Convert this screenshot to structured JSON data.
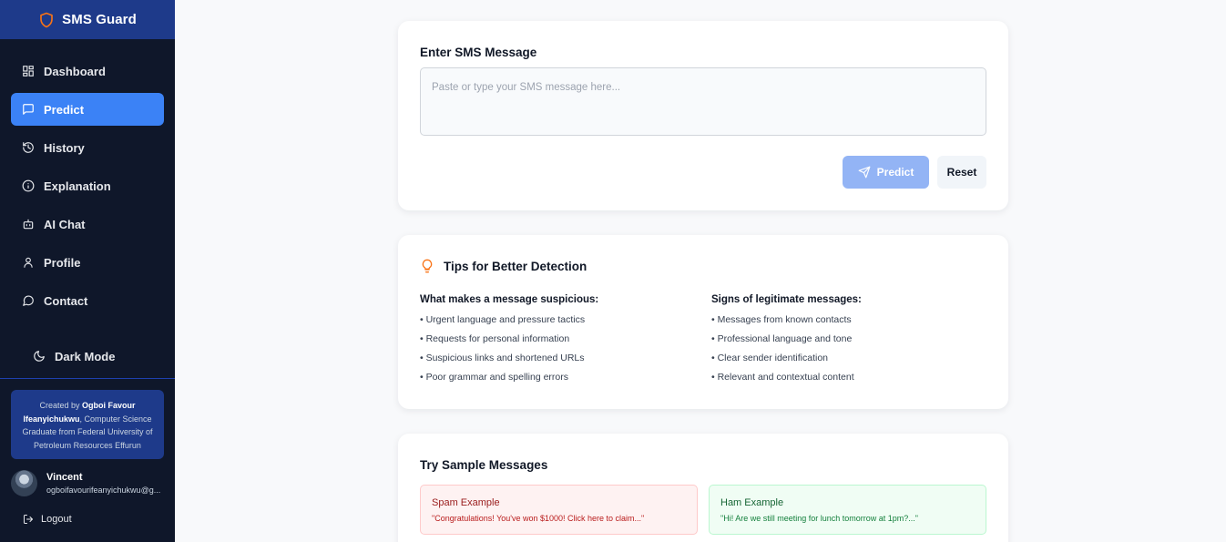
{
  "app": {
    "name": "SMS Guard"
  },
  "sidebar": {
    "items": [
      {
        "label": "Dashboard",
        "icon": "grid-icon"
      },
      {
        "label": "Predict",
        "icon": "message-square-icon",
        "active": true
      },
      {
        "label": "History",
        "icon": "history-icon"
      },
      {
        "label": "Explanation",
        "icon": "info-icon"
      },
      {
        "label": "AI Chat",
        "icon": "bot-icon"
      },
      {
        "label": "Profile",
        "icon": "user-icon"
      },
      {
        "label": "Contact",
        "icon": "message-circle-icon"
      }
    ],
    "dark_mode_label": "Dark Mode",
    "credit": {
      "prefix": "Created by ",
      "name": "Ogboi Favour Ifeanyichukwu",
      "suffix": ", Computer Science Graduate from Federal University of Petroleum Resources Effurun"
    },
    "user": {
      "name": "Vincent",
      "email": "ogboifavourifeanyichukwu@g..."
    },
    "logout_label": "Logout"
  },
  "predict": {
    "title": "Enter SMS Message",
    "placeholder": "Paste or type your SMS message here...",
    "value": "",
    "predict_label": "Predict",
    "reset_label": "Reset"
  },
  "tips": {
    "title": "Tips for Better Detection",
    "suspicious": {
      "title": "What makes a message suspicious:",
      "items": [
        "• Urgent language and pressure tactics",
        "• Requests for personal information",
        "• Suspicious links and shortened URLs",
        "• Poor grammar and spelling errors"
      ]
    },
    "legit": {
      "title": "Signs of legitimate messages:",
      "items": [
        "• Messages from known contacts",
        "• Professional language and tone",
        "• Clear sender identification",
        "• Relevant and contextual content"
      ]
    }
  },
  "samples": {
    "title": "Try Sample Messages",
    "spam": {
      "title": "Spam Example",
      "text": "\"Congratulations! You've won $1000! Click here to claim...\""
    },
    "ham": {
      "title": "Ham Example",
      "text": "\"Hi! Are we still meeting for lunch tomorrow at 1pm?...\""
    }
  },
  "colors": {
    "sidebar_bg": "#0f172a",
    "brand_bg": "#1e3a8a",
    "accent": "#3b82f6",
    "logo_orange": "#f97316",
    "predict_disabled": "#93b4f5"
  }
}
